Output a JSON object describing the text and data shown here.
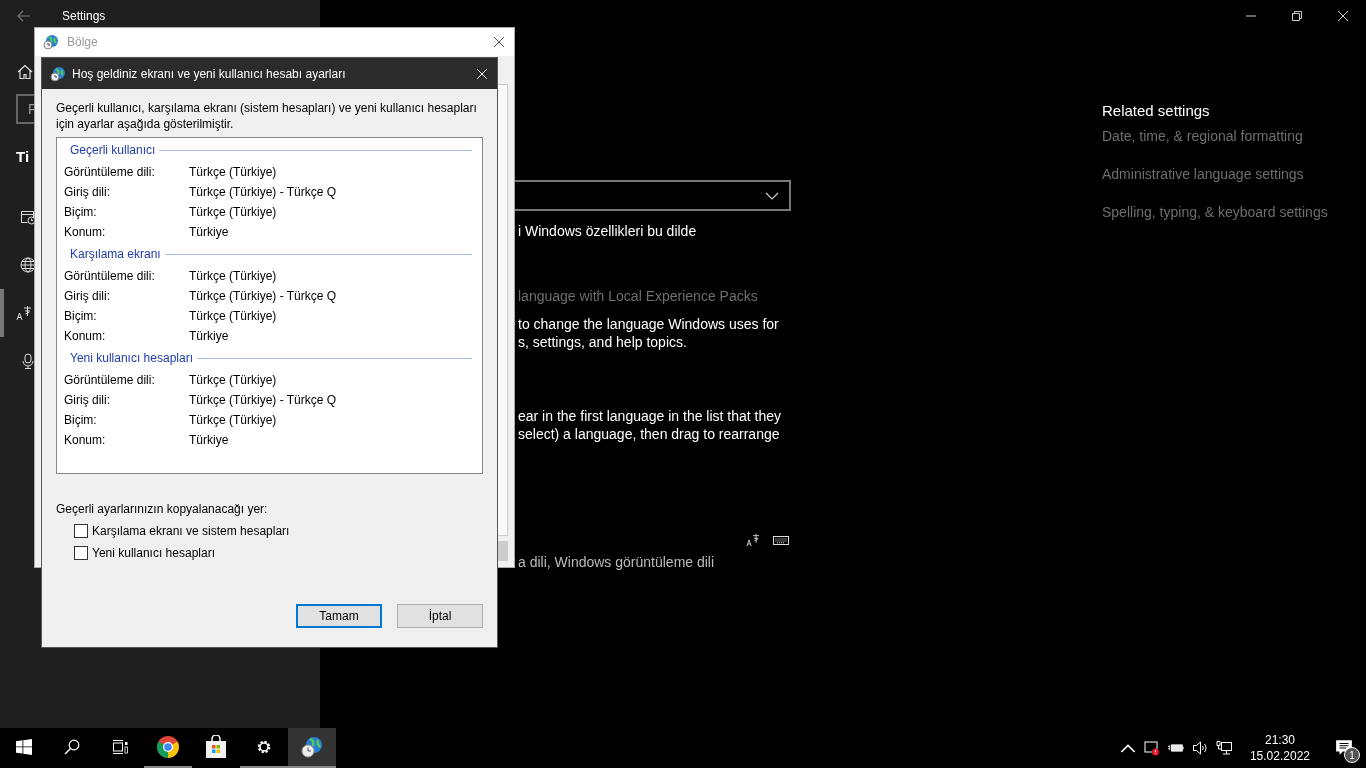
{
  "settings_window": {
    "title": "Settings",
    "search": {
      "placeholder": "F"
    },
    "sidebar": {
      "heading": "Ti",
      "items": [
        {
          "kind": "calendar",
          "selected": false
        },
        {
          "kind": "globe",
          "selected": false
        },
        {
          "kind": "language",
          "selected": true
        },
        {
          "kind": "microphone",
          "selected": false
        }
      ]
    },
    "main": {
      "fragments": [
        {
          "kind": "body",
          "lines": [
            "i Windows özellikleri bu dilde"
          ]
        },
        {
          "kind": "muted",
          "lines": [
            "language with Local Experience Packs"
          ]
        },
        {
          "kind": "body",
          "lines": [
            "to change the language Windows uses for",
            "s, settings, and help topics."
          ]
        },
        {
          "kind": "body",
          "lines": [
            "ear in the first language in the list that they",
            "select) a language, then drag to rearrange"
          ]
        },
        {
          "kind": "caption",
          "lines": [
            "a dili, Windows görüntüleme dili"
          ]
        }
      ]
    },
    "related_settings": {
      "heading": "Related settings",
      "links": [
        "Date, time, & regional formatting",
        "Administrative language settings",
        "Spelling, typing, & keyboard settings"
      ]
    }
  },
  "region_window": {
    "title": "Bölge"
  },
  "dialog": {
    "title": "Hoş geldiniz ekranı ve yeni kullanıcı hesabı ayarları",
    "intro": "Geçerli kullanıcı, karşılama ekranı (sistem hesapları) ve yeni kullanıcı hesapları için ayarlar aşağıda gösterilmiştir.",
    "sections": [
      {
        "heading": "Geçerli kullanıcı",
        "rows": [
          {
            "label": "Görüntüleme dili:",
            "value": "Türkçe (Türkiye)"
          },
          {
            "label": "Giriş dili:",
            "value": "Türkçe (Türkiye) - Türkçe Q"
          },
          {
            "label": "Biçim:",
            "value": "Türkçe (Türkiye)"
          },
          {
            "label": "Konum:",
            "value": "Türkiye"
          }
        ]
      },
      {
        "heading": "Karşılama ekranı",
        "rows": [
          {
            "label": "Görüntüleme dili:",
            "value": "Türkçe (Türkiye)"
          },
          {
            "label": "Giriş dili:",
            "value": "Türkçe (Türkiye) - Türkçe Q"
          },
          {
            "label": "Biçim:",
            "value": "Türkçe (Türkiye)"
          },
          {
            "label": "Konum:",
            "value": "Türkiye"
          }
        ]
      },
      {
        "heading": "Yeni kullanıcı hesapları",
        "rows": [
          {
            "label": "Görüntüleme dili:",
            "value": "Türkçe (Türkiye)"
          },
          {
            "label": "Giriş dili:",
            "value": "Türkçe (Türkiye) - Türkçe Q"
          },
          {
            "label": "Biçim:",
            "value": "Türkçe (Türkiye)"
          },
          {
            "label": "Konum:",
            "value": "Türkiye"
          }
        ]
      }
    ],
    "copy_label": "Geçerli ayarlarınızın kopyalanacağı yer:",
    "options": [
      {
        "label": "Karşılama ekranı ve sistem hesapları",
        "checked": false
      },
      {
        "label": "Yeni kullanıcı hesapları",
        "checked": false
      }
    ],
    "buttons": [
      {
        "label": "Tamam",
        "default": true
      },
      {
        "label": "İptal",
        "default": false
      }
    ]
  },
  "taskbar": {
    "apps": [
      {
        "kind": "start",
        "running": false,
        "active": false
      },
      {
        "kind": "search",
        "running": false,
        "active": false
      },
      {
        "kind": "taskview",
        "running": false,
        "active": false
      },
      {
        "kind": "chrome",
        "running": true,
        "active": false
      },
      {
        "kind": "store",
        "running": false,
        "active": false
      },
      {
        "kind": "settings",
        "running": true,
        "active": false
      },
      {
        "kind": "region",
        "running": true,
        "active": true
      }
    ],
    "time": "21:30",
    "date": "15.02.2022",
    "notification_count": "1"
  }
}
